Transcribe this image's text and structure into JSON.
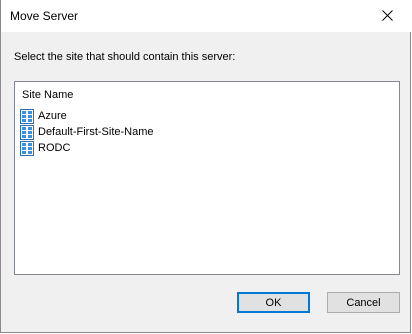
{
  "window": {
    "title": "Move Server"
  },
  "prompt": "Select the site that should contain this server:",
  "list": {
    "column_header": "Site Name",
    "items": [
      {
        "label": "Azure",
        "icon": "site-icon"
      },
      {
        "label": "Default-First-Site-Name",
        "icon": "site-icon"
      },
      {
        "label": "RODC",
        "icon": "site-icon"
      }
    ]
  },
  "buttons": {
    "ok": "OK",
    "cancel": "Cancel"
  },
  "colors": {
    "accent": "#0078d7",
    "dialog_bg": "#f0f0f0",
    "list_bg": "#ffffff"
  }
}
